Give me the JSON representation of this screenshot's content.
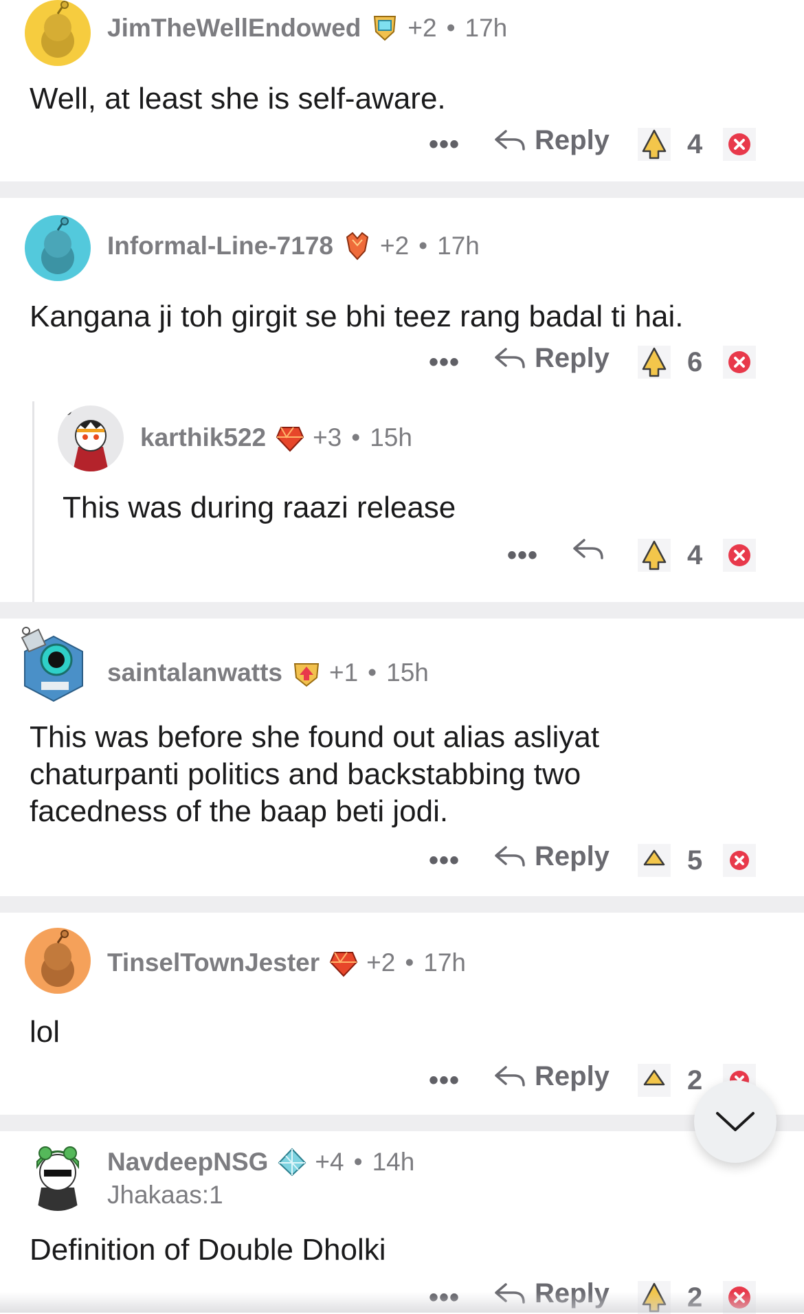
{
  "colors": {
    "separator": "#eeeef0",
    "text": "#1a1a1b",
    "meta": "#7c7c80",
    "downvote": "#e8394b",
    "upvote_fill": "#f3c64b"
  },
  "comments": [
    {
      "username": "JimTheWellEndowed",
      "awards": "+2",
      "time": "17h",
      "body": "Well, at least she is self-aware.",
      "reply_label": "Reply",
      "score": "4",
      "more": "•••",
      "avatar_icon": "snoo-yellow-avatar-icon",
      "flair_icon": "shield-gem-flair-icon"
    },
    {
      "username": "Informal-Line-7178",
      "awards": "+2",
      "time": "17h",
      "body": "Kangana ji toh girgit se bhi teez rang badal ti hai.",
      "reply_label": "Reply",
      "score": "6",
      "more": "•••",
      "avatar_icon": "snoo-teal-avatar-icon",
      "flair_icon": "crystal-flair-icon"
    },
    {
      "username": "karthik522",
      "awards": "+3",
      "time": "15h",
      "body": "This was during raazi release",
      "reply_label": "",
      "score": "4",
      "more": "•••",
      "avatar_icon": "snoo-hero-avatar-icon",
      "flair_icon": "ruby-flair-icon"
    },
    {
      "username": "saintalanwatts",
      "awards": "+1",
      "time": "15h",
      "body_lines": [
        "This was before she found out alias asliyat",
        "chaturpanti politics and backstabbing two",
        "facedness of the baap beti jodi."
      ],
      "reply_label": "Reply",
      "score": "5",
      "more": "•••",
      "avatar_icon": "robot-avatar-icon",
      "flair_icon": "shield-arrow-flair-icon"
    },
    {
      "username": "TinselTownJester",
      "awards": "+2",
      "time": "17h",
      "body": "lol",
      "reply_label": "Reply",
      "score": "2",
      "more": "•••",
      "avatar_icon": "snoo-orange-avatar-icon",
      "flair_icon": "ruby-flair-icon"
    },
    {
      "username": "NavdeepNSG",
      "awards": "+4",
      "time": "14h",
      "subline": "Jhakaas:1",
      "body": "Definition of Double Dholki",
      "reply_label": "Reply",
      "score": "2",
      "more": "•••",
      "avatar_icon": "frog-hat-avatar-icon",
      "flair_icon": "diamond-flair-icon"
    }
  ],
  "fab": {
    "icon": "chevron-down-icon"
  }
}
